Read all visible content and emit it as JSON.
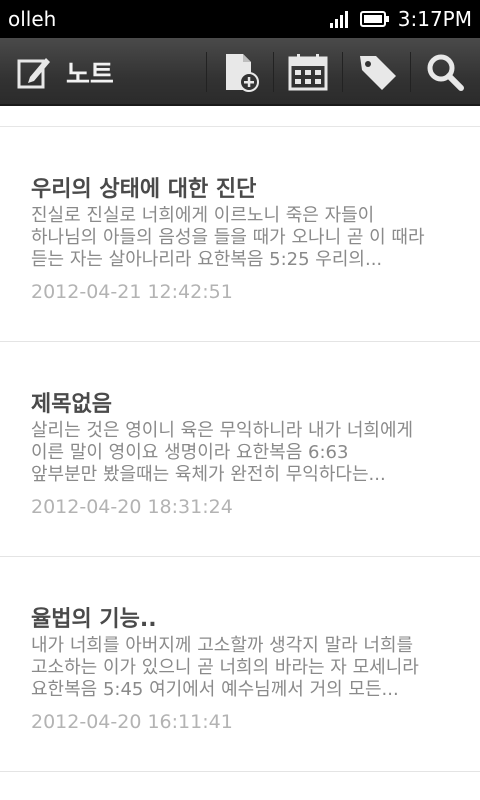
{
  "status_bar": {
    "carrier": "olleh",
    "time": "3:17PM",
    "icons": [
      "signal-icon",
      "battery-icon"
    ]
  },
  "action_bar": {
    "title": "노트",
    "icons": [
      "note-edit-icon",
      "new-note-icon",
      "calendar-icon",
      "tag-icon",
      "search-icon"
    ]
  },
  "notes": [
    {
      "title": "우리의 상태에 대한 진단",
      "body_lines": [
        "진실로 진실로 너희에게 이르노니 죽은 자들이",
        "하나님의 아들의 음성을 들을 때가 오나니 곧 이 때라",
        "듣는 자는 살아나리라  요한복음 5:25  우리의..."
      ],
      "date": "2012-04-21 12:42:51"
    },
    {
      "title": "제목없음",
      "body_lines": [
        "살리는 것은 영이니 육은 무익하니라 내가 너희에게",
        "이른 말이 영이요 생명이라  요한복음 6:63",
        "앞부분만 봤을때는 육체가 완전히 무익하다는..."
      ],
      "date": "2012-04-20 18:31:24"
    },
    {
      "title": "율법의 기능..",
      "body_lines": [
        "내가 너희를 아버지께 고소할까 생각지 말라 너희를",
        "고소하는 이가 있으니 곧 너희의 바라는 자 모세니라",
        "요한복음 5:45  여기에서 예수님께서 거의 모든..."
      ],
      "date": "2012-04-20 16:11:41"
    }
  ],
  "colors": {
    "action_bar": "#333333",
    "title_text": "#4a4a4a",
    "body_text": "#8a8a8a",
    "date_text": "#b3b3b3"
  }
}
